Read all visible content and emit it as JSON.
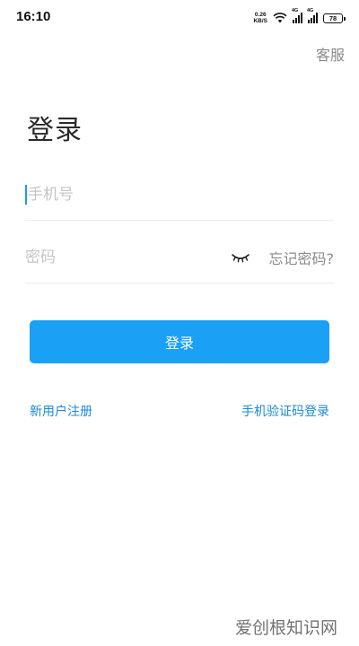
{
  "status_bar": {
    "time": "16:10",
    "net_speed_value": "0.26",
    "net_speed_unit": "KB/S",
    "signal_1_tag": "4G",
    "signal_2_tag": "4G",
    "battery_level": "78"
  },
  "header": {
    "customer_service_label": "客服"
  },
  "main": {
    "title": "登录",
    "phone_field": {
      "placeholder": "手机号",
      "value": ""
    },
    "password_field": {
      "placeholder": "密码",
      "value": ""
    },
    "forgot_password_label": "忘记密码?",
    "login_button_label": "登录",
    "register_link_label": "新用户注册",
    "sms_login_link_label": "手机验证码登录"
  },
  "watermark": "爱创根知识网",
  "colors": {
    "accent": "#1aa0f5",
    "link": "#1a8ad8",
    "muted": "#8a8a8a"
  }
}
